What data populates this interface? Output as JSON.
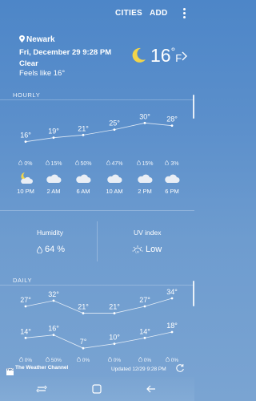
{
  "toolbar": {
    "cities_label": "CITIES",
    "add_label": "ADD",
    "more_icon": "more-vert-icon"
  },
  "current": {
    "location": "Newark",
    "date": "Fri, December 29 9:28 PM",
    "condition": "Clear",
    "feels_like": "Feels like 16°",
    "temperature": "16",
    "degree_symbol": "°",
    "unit": "F",
    "icon": "crescent-moon-icon"
  },
  "hourly": {
    "label": "HOURLY",
    "items": [
      {
        "temp": "16°",
        "precip": "0%",
        "time": "10 PM",
        "icon": "moon-cloud-icon"
      },
      {
        "temp": "19°",
        "precip": "15%",
        "time": "2 AM",
        "icon": "cloud-icon"
      },
      {
        "temp": "21°",
        "precip": "50%",
        "time": "6 AM",
        "icon": "cloud-icon"
      },
      {
        "temp": "25°",
        "precip": "47%",
        "time": "10 AM",
        "icon": "cloud-icon"
      },
      {
        "temp": "30°",
        "precip": "15%",
        "time": "2 PM",
        "icon": "cloud-icon"
      },
      {
        "temp": "28°",
        "precip": "3%",
        "time": "6 PM",
        "icon": "cloud-icon"
      }
    ]
  },
  "details": {
    "humidity_label": "Humidity",
    "humidity_value": "64 %",
    "uv_label": "UV index",
    "uv_value": "Low"
  },
  "daily": {
    "label": "DAILY",
    "highs": [
      "27°",
      "32°",
      "21°",
      "21°",
      "27°",
      "34°"
    ],
    "lows": [
      "14°",
      "16°",
      "7°",
      "10°",
      "14°",
      "18°"
    ],
    "precip": [
      "0%",
      "50%",
      "0%",
      "0%",
      "0%",
      "0%"
    ]
  },
  "footer": {
    "brand": "The Weather Channel",
    "logo_text": "The Weather Channel",
    "updated": "Updated 12/29 9:28 PM"
  },
  "colors": {
    "background_top": "#4d86c8",
    "background_bottom": "#7aa4d2",
    "text": "#ffffff"
  },
  "navbar": {
    "icons": [
      "recent-apps-icon",
      "home-icon",
      "back-icon"
    ]
  }
}
